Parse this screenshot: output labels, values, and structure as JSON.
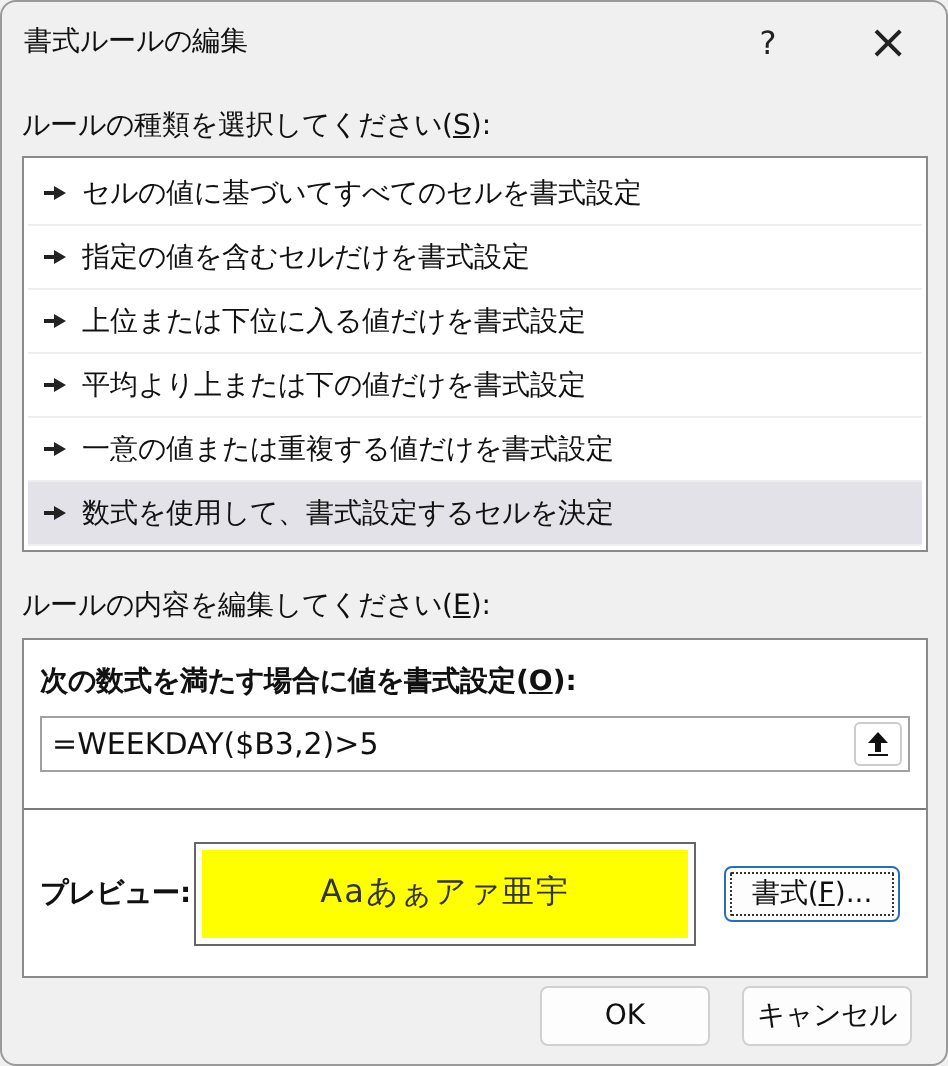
{
  "window": {
    "title": "書式ルールの編集",
    "help": "?",
    "close": "×"
  },
  "rule_type": {
    "label_before": "ルールの種類を選択してください(",
    "access_key": "S",
    "label_after": "):",
    "items": [
      {
        "label": "セルの値に基づいてすべてのセルを書式設定",
        "selected": false
      },
      {
        "label": "指定の値を含むセルだけを書式設定",
        "selected": false
      },
      {
        "label": "上位または下位に入る値だけを書式設定",
        "selected": false
      },
      {
        "label": "平均より上または下の値だけを書式設定",
        "selected": false
      },
      {
        "label": "一意の値または重複する値だけを書式設定",
        "selected": false
      },
      {
        "label": "数式を使用して、書式設定するセルを決定",
        "selected": true
      }
    ]
  },
  "rule_edit": {
    "label_before": "ルールの内容を編集してください(",
    "access_key": "E",
    "label_after": "):",
    "formula_label": {
      "label_before": "次の数式を満たす場合に値を書式設定(",
      "access_key": "O",
      "label_after": "):"
    },
    "formula": "=WEEKDAY($B3,2)>5",
    "preview_label": "プレビュー:",
    "preview_text": "Aaあぁアァ亜宇",
    "format_button": {
      "label_before": "書式(",
      "access_key": "F",
      "label_after": ")..."
    }
  },
  "buttons": [
    "OK",
    "キャンセル"
  ]
}
